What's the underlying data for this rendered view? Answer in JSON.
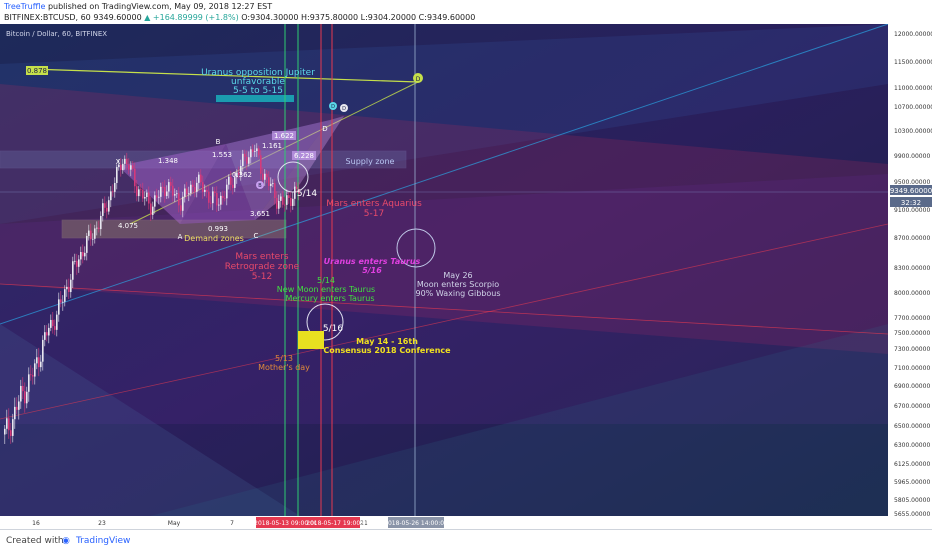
{
  "header": {
    "author": "TreeTruffle",
    "published": "published on TradingView.com, May 09, 2018 12:27 EST",
    "symbol": "BITFINEX:BTCUSD, 60",
    "last_price": "9349.60000",
    "change": "▲ +164.89999 (+1.8%)",
    "open": "O:9304.30000",
    "high": "H:9375.80000",
    "low": "L:9304.20000",
    "close": "C:9349.60000"
  },
  "chart_title": "Bitcoin / Dollar, 60, BITFINEX",
  "footer": {
    "created_with": "Created with",
    "brand": "TradingView"
  },
  "colors": {
    "background": "#1a1d45",
    "candle_up": "#e8e8f0",
    "candle_down": "#d63a7a",
    "text_light": "#d0d4e8"
  },
  "chart_data": {
    "type": "candlestick",
    "title": "Bitcoin / Dollar, 60, BITFINEX",
    "y_axis": {
      "ticks": [
        "12000.00000",
        "11500.00000",
        "11000.00000",
        "10700.00000",
        "10300.00000",
        "9900.00000",
        "9500.00000",
        "9100.00000",
        "8700.00000",
        "8300.00000",
        "8000.00000",
        "7700.00000",
        "7500.00000",
        "7300.00000",
        "7100.00000",
        "6900.00000",
        "6700.00000",
        "6500.00000",
        "6300.00000",
        "6125.00000",
        "5965.00000",
        "5805.00000",
        "5655.00000"
      ],
      "current_price_label": "9349.60000",
      "countdown_label": "32:32"
    },
    "x_axis": {
      "ticks": [
        "16",
        "23",
        "May",
        "7",
        "21"
      ],
      "highlight_labels": [
        "2018-05-13 09:00:00",
        "2018-05-17 19:00:00",
        "2018-05-26 14:00:00"
      ]
    },
    "price_path": [
      6400,
      6550,
      6750,
      6900,
      7050,
      7300,
      7550,
      7700,
      7950,
      8200,
      8400,
      8600,
      8750,
      8950,
      9200,
      9500,
      9850,
      9700,
      9400,
      9250,
      9150,
      9300,
      9450,
      9300,
      9200,
      9350,
      9500,
      9400,
      9250,
      9200,
      9350,
      9500,
      9700,
      9900,
      10000,
      9650,
      9450,
      9250,
      9150,
      9300,
      9349.6
    ],
    "labels": {
      "fib_0878": "0.878",
      "uranus_title": "Uranus opposition Jupiter",
      "uranus_sub": "unfavorable",
      "uranus_dates": "5-5 to 5-15",
      "supply_zone": "Supply zone",
      "demand_zones": "Demand zones",
      "x": "X",
      "a": "A",
      "b": "B",
      "c": "C",
      "d": "D",
      "b2": "B",
      "r1348": "1.348",
      "r1553": "1.553",
      "r1622": "1.622",
      "r1161": "1.161",
      "r6228": "6.228",
      "r0362": "0.362",
      "r0993": "0.993",
      "r4075": "4.075",
      "r3651": "3.651",
      "date_514": "5/14",
      "date_516": "5/16",
      "mars_aquarius": "Mars enters Aquarius",
      "mars_aquarius_date": "5-17",
      "mars_enters": "Mars enters",
      "retrograde_zone": "Retrograde zone",
      "retro_date": "5-12",
      "uranus_taurus": "Uranus enters Taurus",
      "uranus_taurus_date": "5/16",
      "new_moon_date": "5/14",
      "new_moon": "New Moon enters Taurus",
      "mercury": "Mercury enters Taurus",
      "may26": "May 26",
      "moon_scorpio": "Moon enters Scorpio",
      "waxing": "90% Waxing Gibbous",
      "mothers_date": "5/13",
      "mothers_day": "Mother's day",
      "consensus_dates": "May 14 - 16th",
      "consensus": "Consensus 2018 Conference"
    }
  }
}
